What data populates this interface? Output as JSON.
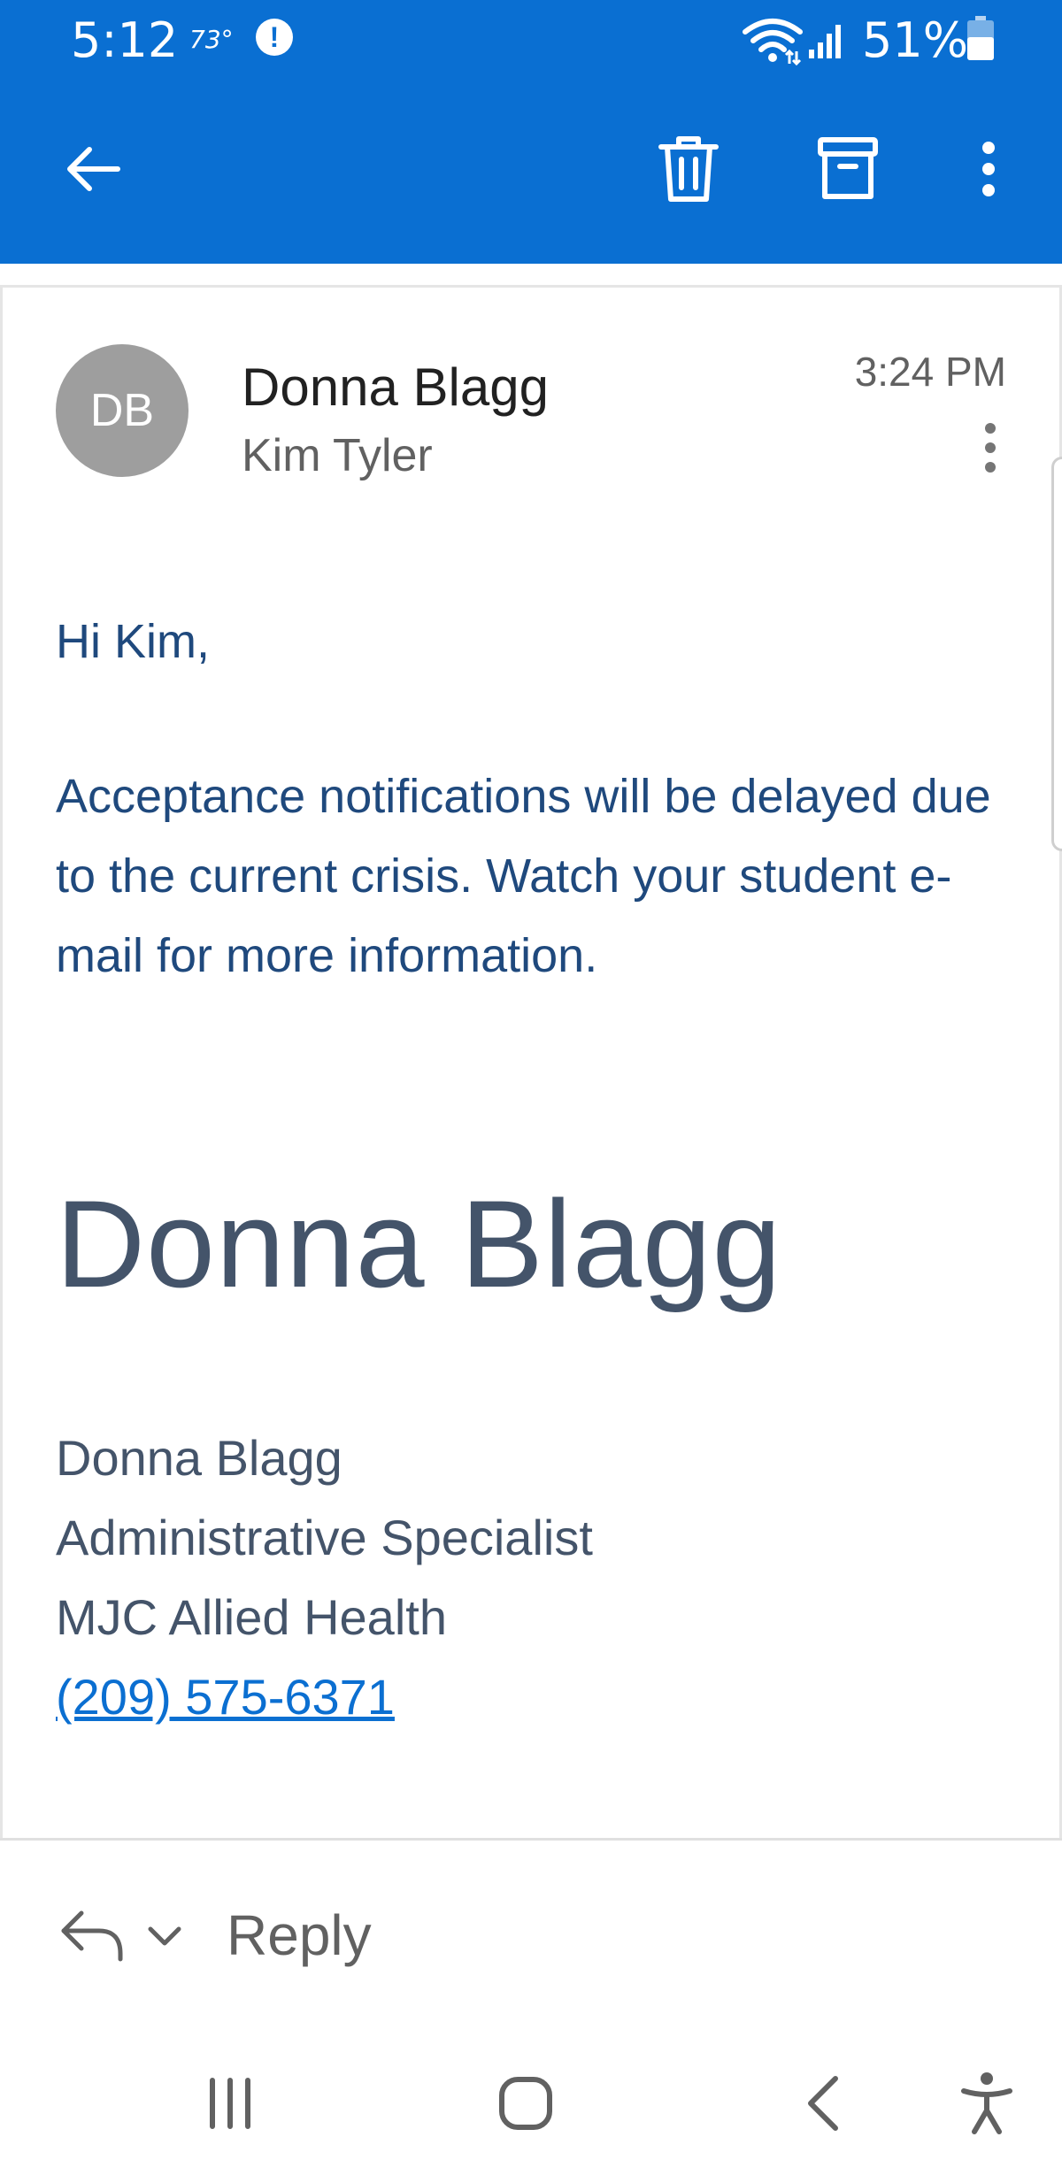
{
  "status_bar": {
    "time": "5:12",
    "temperature": "73°",
    "alert_glyph": "!",
    "battery_percent": "51%",
    "icons": [
      "wifi-icon",
      "signal-icon",
      "battery-icon",
      "alert-icon"
    ]
  },
  "toolbar": {
    "background_color": "#0A6FD2",
    "icons": [
      "back-arrow-icon",
      "trash-icon",
      "archive-icon",
      "more-vertical-icon"
    ]
  },
  "message": {
    "avatar_initials": "DB",
    "sender": "Donna Blagg",
    "recipient": "Kim Tyler",
    "time": "3:24 PM",
    "greeting": "Hi Kim,",
    "body": "Acceptance notifications will be delayed due to the current crisis. Watch your student e-mail for more information.",
    "signature": {
      "display_name": "Donna Blagg",
      "name": "Donna Blagg",
      "title": "Administrative Specialist",
      "organization": "MJC Allied Health",
      "phone": "(209) 575-6371"
    }
  },
  "reply_bar": {
    "label": "Reply",
    "icons": [
      "reply-icon",
      "chevron-down-icon"
    ]
  },
  "nav_bar": {
    "icons": [
      "recent-apps-icon",
      "home-icon",
      "nav-back-icon",
      "accessibility-icon"
    ]
  }
}
